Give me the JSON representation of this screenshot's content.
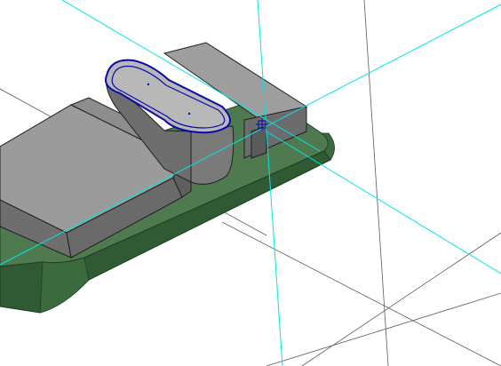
{
  "viewport": {
    "background": "#ffffff",
    "model_name": "",
    "status_text": ""
  },
  "colors": {
    "base_plate_top": "#4f7a4f",
    "base_plate_side": "#2f5a33",
    "base_plate_edge": "#1d3d21",
    "block_top": "#9b9b9b",
    "block_front": "#6e6e6e",
    "block_side": "#7e7e7e",
    "block_edge": "#1f1f1f",
    "boss_top": "#b8b8b8",
    "boss_side": "#7a7a7a",
    "selection_edge": "#0a0aa8",
    "construction_line": "#00e6e6",
    "grid_line": "#5a5a5a"
  },
  "icons": {
    "origin": "origin-marker-icon"
  }
}
